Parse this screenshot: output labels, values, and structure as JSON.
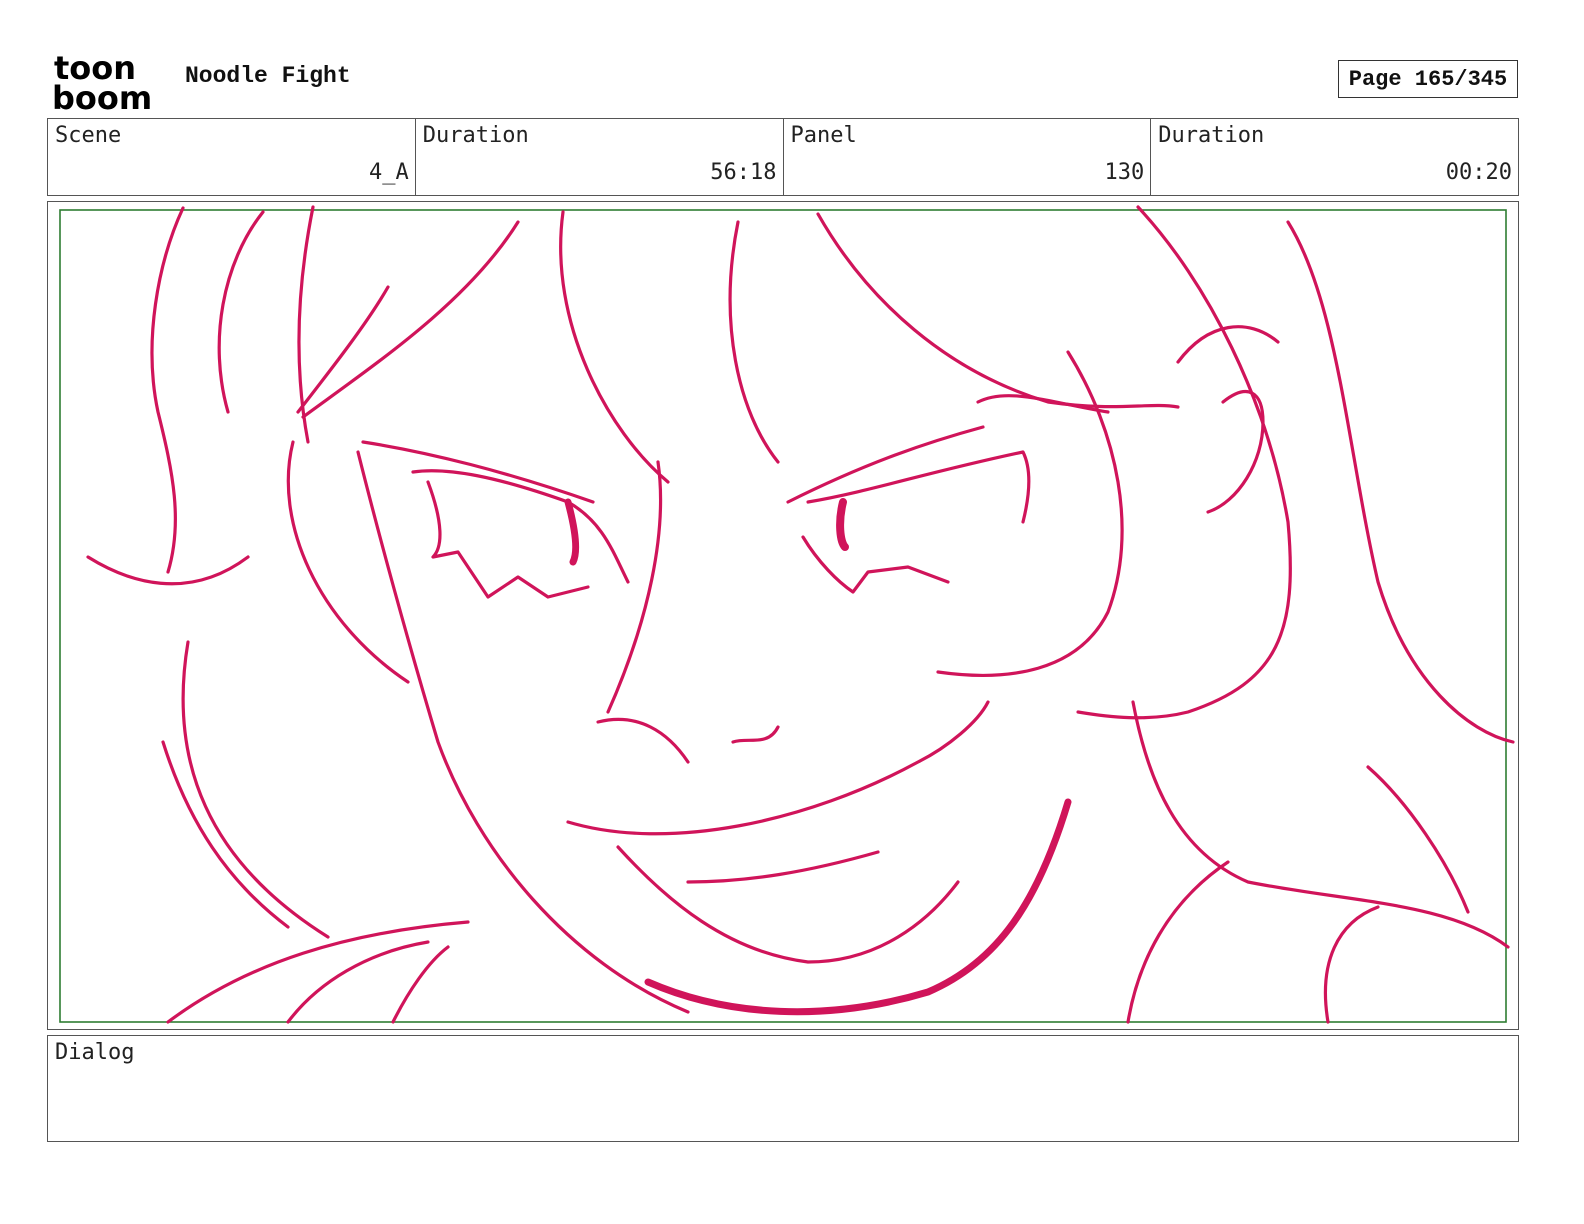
{
  "logo": {
    "line1": "toon",
    "line2": "boom"
  },
  "header": {
    "title": "Noodle Fight",
    "page": "Page 165/345"
  },
  "info": {
    "scene_label": "Scene",
    "scene_value": "4_A",
    "duration_label": "Duration",
    "duration_value": "56:18",
    "panel_label": "Panel",
    "panel_value": "130",
    "panel_duration_label": "Duration",
    "panel_duration_value": "00:20"
  },
  "dialog": {
    "label": "Dialog"
  },
  "colors": {
    "sketch": "#d0145a",
    "safe_frame": "#2e7d32",
    "border": "#555555"
  }
}
